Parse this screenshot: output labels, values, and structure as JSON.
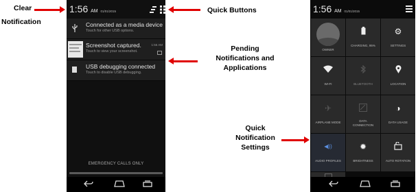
{
  "annotations": {
    "clear": "Clear",
    "notification": "Notification",
    "quick_buttons": "Quick Buttons",
    "pending_l1": "Pending",
    "pending_l2": "Notifications and",
    "pending_l3": "Applications",
    "qns_l1": "Quick",
    "qns_l2": "Notification",
    "qns_l3": "Settings"
  },
  "phone1": {
    "clock": "1:56",
    "ampm": "AM",
    "date": "01/01/2015",
    "notifications": [
      {
        "title": "Connected as a media device",
        "subtitle": "Touch for other USB options.",
        "time": "",
        "icon": "usb-icon"
      },
      {
        "title": "Screenshot captured.",
        "subtitle": "Touch to view your screenshot.",
        "time": "1:56 AM",
        "icon": "screenshot-thumbnail"
      },
      {
        "title": "USB debugging connected",
        "subtitle": "Touch to disable USB debugging.",
        "time": "",
        "icon": "usb-debug-icon"
      }
    ],
    "emergency": "EMERGENCY CALLS ONLY"
  },
  "phone2": {
    "clock": "1:56",
    "ampm": "AM",
    "date": "01/01/2015",
    "tiles": {
      "owner": "OWNER",
      "charging": "CHARGING, 95%",
      "settings": "SETTINGS",
      "wifi": "WI-FI",
      "bluetooth": "BLUETOOTH",
      "location": "LOCATION",
      "airplane": "AIRPLANE MODE",
      "data_conn_1": "DATA",
      "data_conn_2": "CONNECTION",
      "data_usage": "DATA USAGE",
      "audio": "AUDIO PROFILES",
      "brightness": "BRIGHTNESS",
      "rotation": "AUTO ROTATION"
    }
  },
  "colors": {
    "arrow": "#e00000",
    "tile": "#2a2a2a",
    "panel": "#0d0d0d"
  }
}
